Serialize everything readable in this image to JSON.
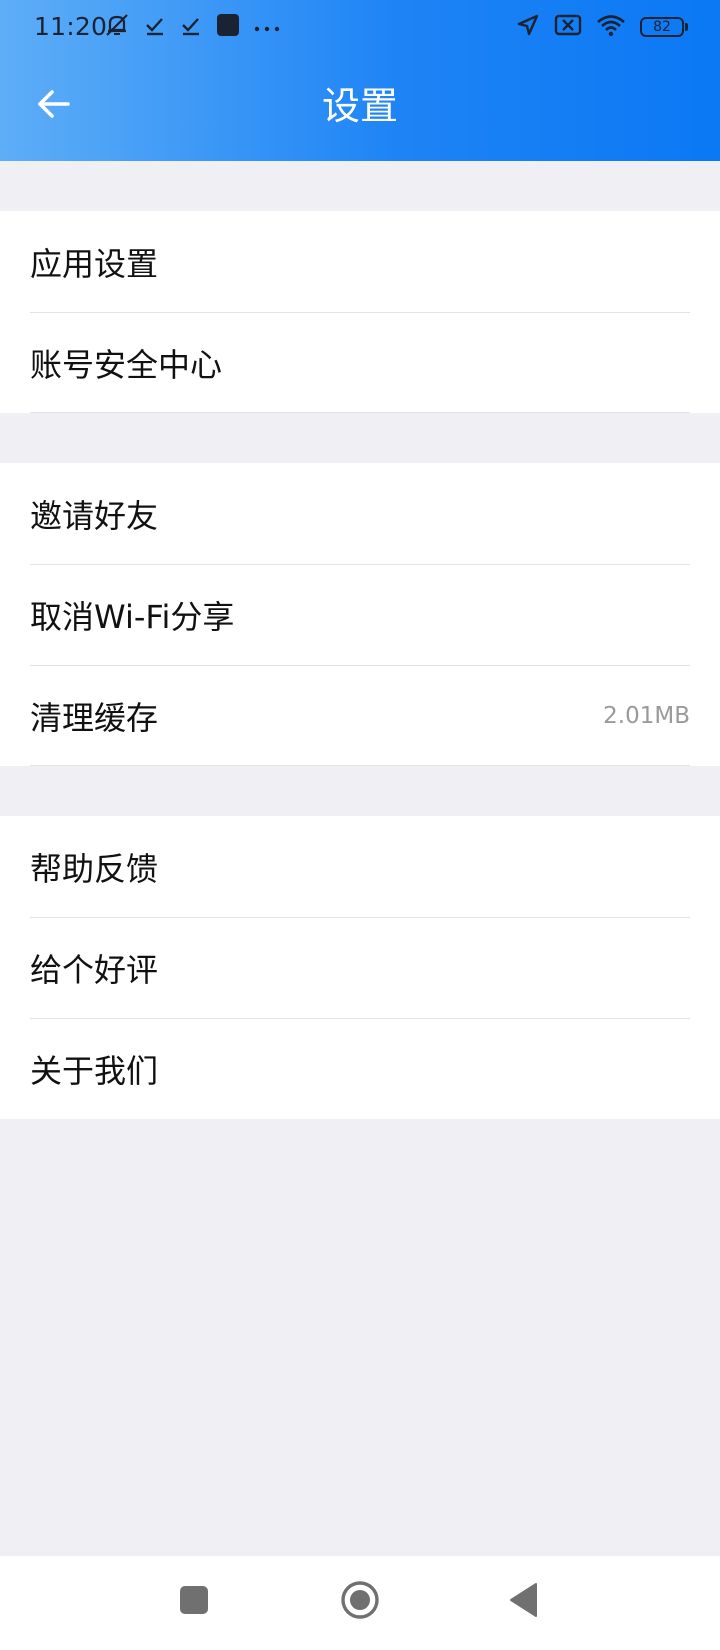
{
  "status_bar": {
    "time": "11:20",
    "battery_level": "82"
  },
  "header": {
    "title": "设置"
  },
  "groups": [
    {
      "items": [
        {
          "label": "应用设置"
        },
        {
          "label": "账号安全中心"
        }
      ]
    },
    {
      "items": [
        {
          "label": "邀请好友"
        },
        {
          "label": "取消Wi-Fi分享"
        },
        {
          "label": "清理缓存",
          "value": "2.01MB"
        }
      ]
    },
    {
      "items": [
        {
          "label": "帮助反馈"
        },
        {
          "label": "给个好评"
        },
        {
          "label": "关于我们"
        }
      ]
    }
  ],
  "colors": {
    "header_gradient_start": "#5eaef7",
    "header_gradient_end": "#0b78f4",
    "page_background": "#efeff4"
  },
  "icons": {
    "back": "arrow-left-icon",
    "nav_recents": "square-icon",
    "nav_home": "circle-icon",
    "nav_back": "triangle-left-icon"
  }
}
